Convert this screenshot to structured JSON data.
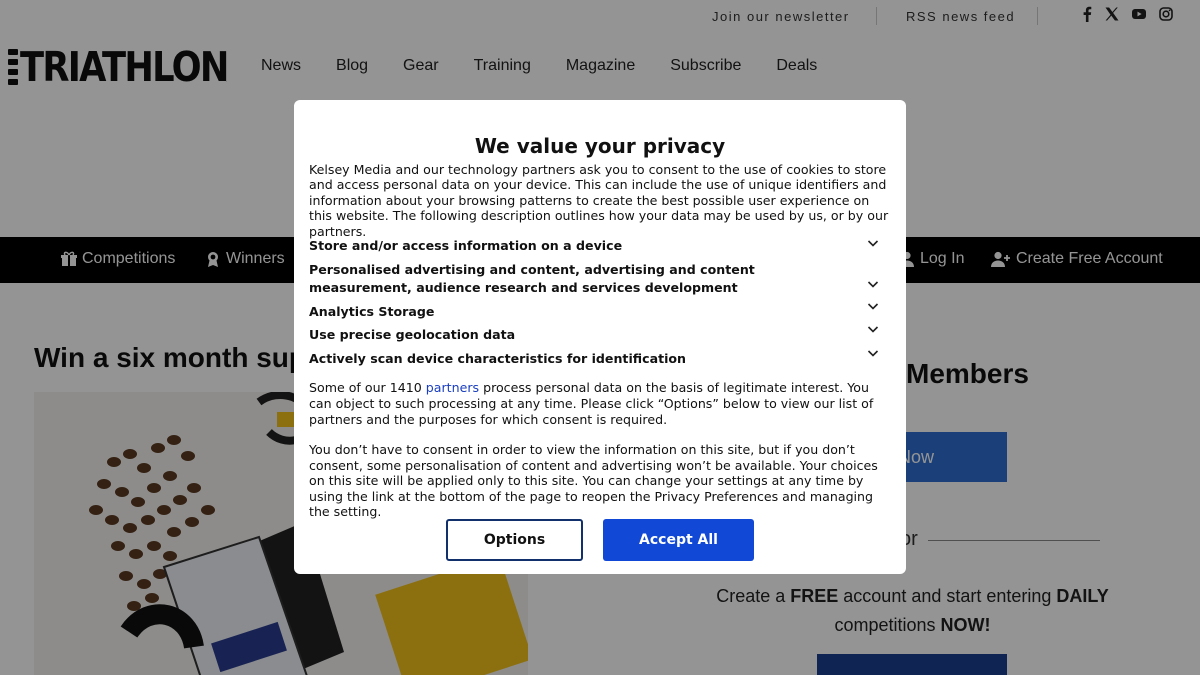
{
  "utility": {
    "newsletter": "Join our newsletter",
    "rss": "RSS news feed",
    "social": [
      "facebook-icon",
      "x-icon",
      "youtube-icon",
      "instagram-icon"
    ]
  },
  "header": {
    "logo": "TRIATHLON",
    "nav": [
      "News",
      "Blog",
      "Gear",
      "Training",
      "Magazine",
      "Subscribe",
      "Deals"
    ]
  },
  "blackbar": {
    "competitions": "Competitions",
    "winners": "Winners",
    "login": "Log In",
    "create_account": "Create Free Account"
  },
  "main": {
    "headline": "Win a six month sup"
  },
  "sidebar": {
    "members_title": "Members",
    "join_label": "n Now",
    "or": "or",
    "free_prefix": "Create a ",
    "free_bold": "FREE",
    "free_mid": " account and start entering ",
    "free_bold2": "DAILY",
    "free_mid2": " competitions ",
    "free_bold3": "NOW!"
  },
  "modal": {
    "title": "We value your privacy",
    "intro": "Kelsey Media and our technology partners ask you to consent to the use of cookies to store and access personal data on your device. This can include the use of unique identifiers and information about your browsing patterns to create the best possible user experience on this website. The following description outlines how your data may be used by us, or by our partners.",
    "purposes": [
      "Store and/or access information on a device",
      "Personalised advertising and content, advertising and content measurement, audience research and services development",
      "Analytics Storage",
      "Use precise geolocation data",
      "Actively scan device characteristics for identification"
    ],
    "legit_prefix": "Some of our 1410 ",
    "legit_link": "partners",
    "legit_suffix": " process personal data on the basis of legitimate interest. You can object to such processing at any time. Please click “Options” below to view our list of partners and the purposes for which consent is required.",
    "consent_text": "You don’t have to consent in order to view the information on this site, but if you don’t consent, some personalisation of content and advertising won’t be available. Your choices on this site will be applied only to this site. You can change your settings at any time by using the link at the bottom of the page to reopen the Privacy Preferences and managing the setting.",
    "options_label": "Options",
    "accept_label": "Accept All"
  },
  "colors": {
    "accept": "#1148d6",
    "join": "#2f6fd1",
    "link": "#1a3ec0"
  }
}
